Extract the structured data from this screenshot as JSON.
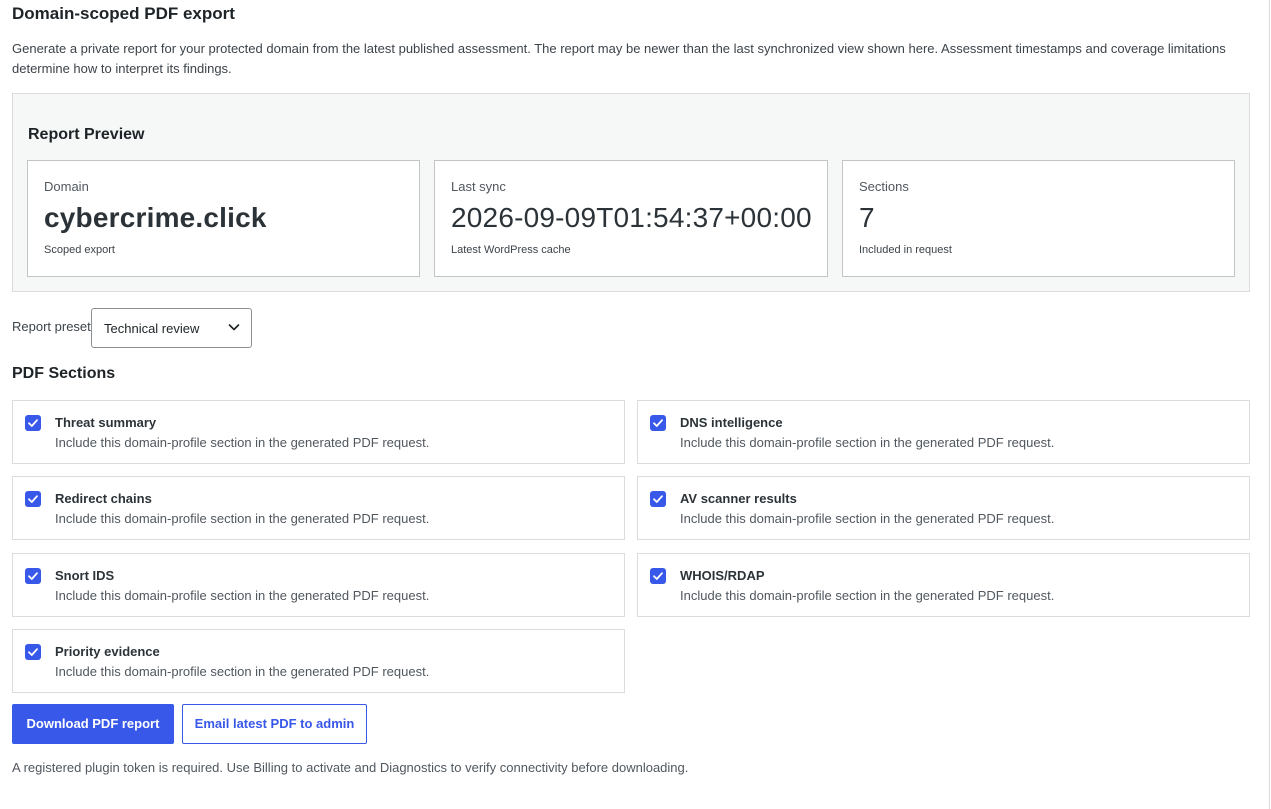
{
  "page": {
    "title": "Domain-scoped PDF export",
    "intro": "Generate a private report for your protected domain from the latest published assessment. The report may be newer than the last synchronized view shown here. Assessment timestamps and coverage limitations determine how to interpret its findings."
  },
  "preview": {
    "title": "Report Preview",
    "cards": [
      {
        "label": "Domain",
        "value": "cybercrime.click",
        "sub": "Scoped export"
      },
      {
        "label": "Last sync",
        "value": "2026-09-09T01:54:37+00:00",
        "sub": "Latest WordPress cache"
      },
      {
        "label": "Sections",
        "value": "7",
        "sub": "Included in request"
      }
    ]
  },
  "preset": {
    "label": "Report preset",
    "selected": "Technical review"
  },
  "sections": {
    "title": "PDF Sections",
    "description": "Include this domain-profile section in the generated PDF request.",
    "items": [
      {
        "label": "Threat summary",
        "checked": true
      },
      {
        "label": "DNS intelligence",
        "checked": true
      },
      {
        "label": "Redirect chains",
        "checked": true
      },
      {
        "label": "AV scanner results",
        "checked": true
      },
      {
        "label": "Snort IDS",
        "checked": true
      },
      {
        "label": "WHOIS/RDAP",
        "checked": true
      },
      {
        "label": "Priority evidence",
        "checked": true
      }
    ]
  },
  "actions": {
    "download_label": "Download PDF report",
    "email_label": "Email latest PDF to admin"
  },
  "footnote": "A registered plugin token is required. Use Billing to activate and Diagnostics to verify connectivity before downloading.",
  "colors": {
    "accent": "#3858e9",
    "panel_bg": "#f6f7f7",
    "border": "#dcdcde"
  }
}
